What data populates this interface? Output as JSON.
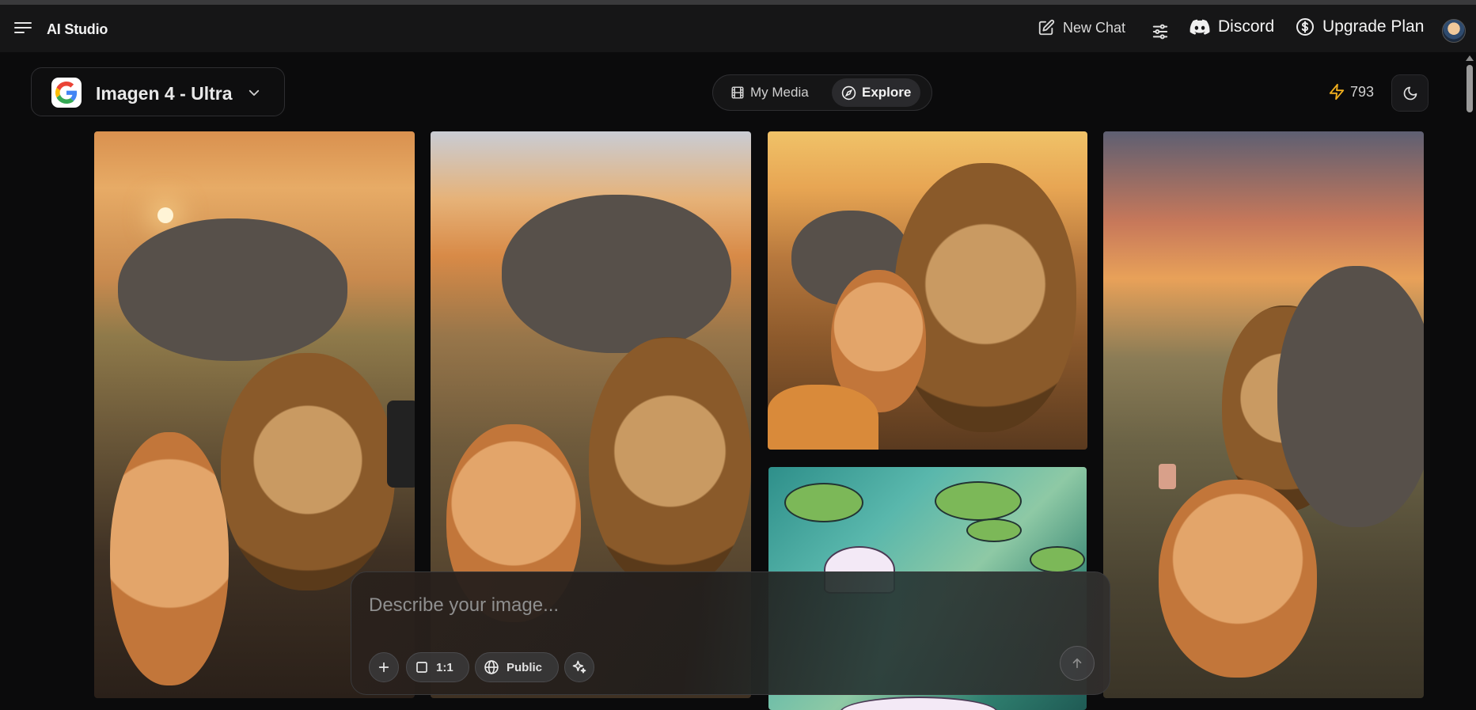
{
  "app": {
    "title": "AI Studio"
  },
  "topbar": {
    "new_chat": "New Chat",
    "discord": "Discord",
    "upgrade": "Upgrade Plan",
    "icons": [
      "menu-icon",
      "pencil-square-icon",
      "sliders-icon",
      "discord-icon",
      "dollar-circle-icon",
      "avatar"
    ]
  },
  "model": {
    "name": "Imagen 4 - Ultra",
    "icon": "google-logo"
  },
  "tabs": {
    "my_media": "My Media",
    "explore": "Explore",
    "active": "Explore"
  },
  "credits": {
    "count": "793",
    "icon": "lightning-icon",
    "color": "#f2b01e"
  },
  "gallery": {
    "images": [
      "lion, cat and rhino savanna selfie at sunset",
      "cat and lion with rhino in savanna",
      "cat and lion selfie close-up",
      "stained glass water lilies",
      "cat taking selfie with lion and rhino"
    ]
  },
  "prompt": {
    "placeholder": "Describe your image...",
    "aspect_ratio": "1:1",
    "visibility": "Public"
  }
}
